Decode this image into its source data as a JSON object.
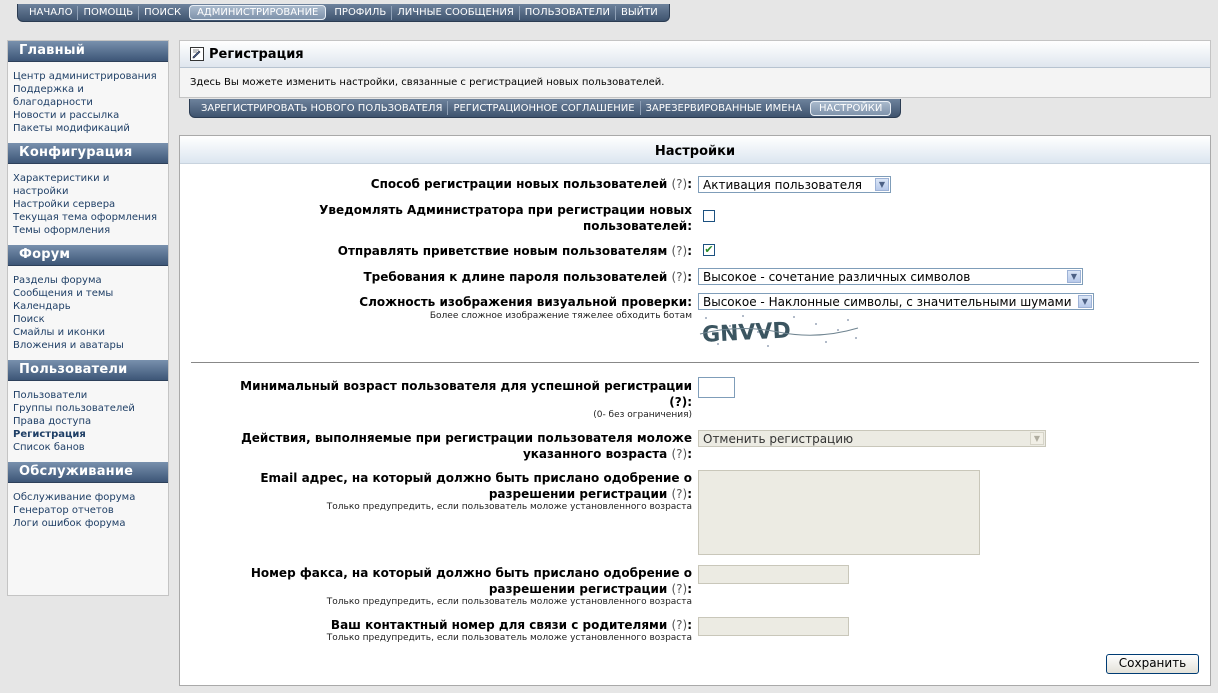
{
  "top_nav": {
    "items": [
      {
        "label": "НАЧАЛО",
        "active": false
      },
      {
        "label": "ПОМОЩЬ",
        "active": false
      },
      {
        "label": "ПОИСК",
        "active": false
      },
      {
        "label": "АДМИНИСТРИРОВАНИЕ",
        "active": true
      },
      {
        "label": "ПРОФИЛЬ",
        "active": false
      },
      {
        "label": "ЛИЧНЫЕ СООБЩЕНИЯ",
        "active": false
      },
      {
        "label": "ПОЛЬЗОВАТЕЛИ",
        "active": false
      },
      {
        "label": "ВЫЙТИ",
        "active": false
      }
    ]
  },
  "sidebar": {
    "sections": [
      {
        "title": "Главный",
        "links": [
          "Центр администрирования",
          "Поддержка и благодарности",
          "Новости и рассылка",
          "Пакеты модификаций"
        ]
      },
      {
        "title": "Конфигурация",
        "links": [
          "Характеристики и настройки",
          "Настройки сервера",
          "Текущая тема оформления",
          "Темы оформления"
        ]
      },
      {
        "title": "Форум",
        "links": [
          "Разделы форума",
          "Сообщения и темы",
          "Календарь",
          "Поиск",
          "Смайлы и иконки",
          "Вложения и аватары"
        ]
      },
      {
        "title": "Пользователи",
        "links": [
          "Пользователи",
          "Группы пользователей",
          "Права доступа",
          "Регистрация",
          "Список банов"
        ]
      },
      {
        "title": "Обслуживание",
        "links": [
          "Обслуживание форума",
          "Генератор отчетов",
          "Логи ошибок форума"
        ]
      }
    ],
    "active_link": "Регистрация"
  },
  "page": {
    "title": "Регистрация",
    "description": "Здесь Вы можете изменить настройки, связанные с регистрацией новых пользователей."
  },
  "tabs": {
    "items": [
      {
        "label": "ЗАРЕГИСТРИРОВАТЬ НОВОГО ПОЛЬЗОВАТЕЛЯ",
        "active": false
      },
      {
        "label": "РЕГИСТРАЦИОННОЕ СОГЛАШЕНИЕ",
        "active": false
      },
      {
        "label": "ЗАРЕЗЕРВИРОВАННЫЕ ИМЕНА",
        "active": false
      },
      {
        "label": "НАСТРОЙКИ",
        "active": true
      }
    ]
  },
  "settings": {
    "header": "Настройки",
    "help_marker": "(?)",
    "reg_method": {
      "label": "Способ регистрации новых пользователей",
      "value": "Активация пользователя"
    },
    "notify_admin": {
      "label_line1": "Уведомлять Администратора при регистрации новых",
      "label_line2": "пользователей:",
      "checked": false
    },
    "send_welcome": {
      "label": "Отправлять приветствие новым пользователям",
      "checked": true
    },
    "password_strength": {
      "label": "Требования к длине пароля пользователей",
      "value": "Высокое - сочетание различных символов"
    },
    "captcha": {
      "label": "Сложность изображения визуальной проверки:",
      "note": "Более сложное изображение тяжелее обходить ботам",
      "value": "Высокое - Наклонные символы, с значительными шумами",
      "image_text": "GNVVD"
    },
    "min_age": {
      "label_line1": "Минимальный возраст пользователя для успешной регистрации",
      "label_line2": "(?):",
      "note": "(0- без ограничения)",
      "value": ""
    },
    "underage_action": {
      "label_line1": "Действия, выполняемые при регистрации пользователя моложе",
      "label_line2": "указанного возраста",
      "value": "Отменить регистрацию"
    },
    "approval_email": {
      "label_line1": "Email адрес, на который должно быть прислано одобрение о",
      "label_line2": "разрешении регистрации",
      "note": "Только предупредить, если пользователь моложе установленного возраста"
    },
    "approval_fax": {
      "label_line1": "Номер факса, на который должно быть прислано одобрение о",
      "label_line2": "разрешении регистрации",
      "note": "Только предупредить, если пользователь моложе установленного возраста"
    },
    "parent_phone": {
      "label": "Ваш контактный номер для связи с родителями",
      "note": "Только предупредить, если пользователь моложе установленного возраста"
    },
    "save_label": "Сохранить"
  }
}
